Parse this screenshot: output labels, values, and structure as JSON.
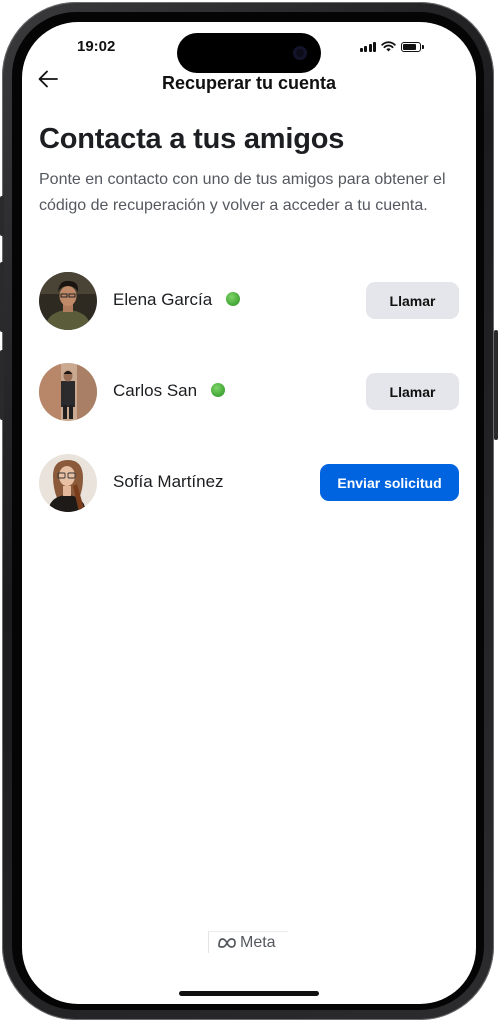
{
  "status_bar": {
    "time": "19:02",
    "icons": [
      "signal-icon",
      "wifi-icon",
      "battery-icon"
    ]
  },
  "header": {
    "back_icon": "back-arrow-icon",
    "title": "Recuperar tu cuenta"
  },
  "main": {
    "title": "Contacta a tus amigos",
    "description": "Ponte en contacto con uno de tus amigos para obtener el código de recuperación y volver a acceder a tu cuenta.",
    "contacts": [
      {
        "name": "Elena García",
        "online": true,
        "action_label": "Llamar"
      },
      {
        "name": "Carlos San",
        "online": true,
        "action_label": "Llamar"
      },
      {
        "name": "Sofía Martínez",
        "online": false,
        "action_label": "Enviar solicitud"
      }
    ]
  },
  "footer": {
    "brand": "Meta",
    "brand_icon": "meta-infinity-icon"
  },
  "colors": {
    "primary_blue": "#0064e0",
    "secondary_button": "#e4e6eb",
    "online_green": "#4caf3f",
    "text_primary": "#1c1e21",
    "text_secondary": "#55595f"
  }
}
